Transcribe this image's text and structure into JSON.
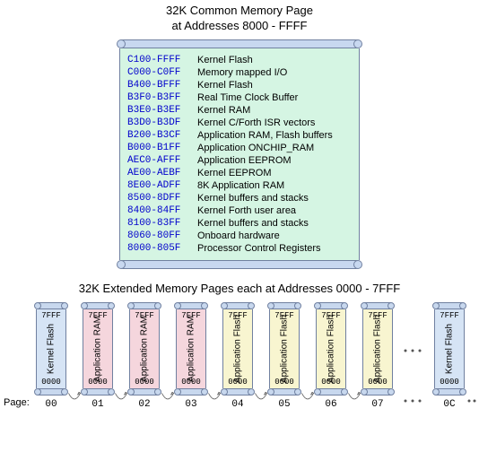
{
  "title_line1": "32K Common Memory Page",
  "title_line2": "at Addresses 8000 - FFFF",
  "common_rows": [
    {
      "addr": "C100-FFFF",
      "desc": "Kernel Flash"
    },
    {
      "addr": "C000-C0FF",
      "desc": "Memory mapped I/O"
    },
    {
      "addr": "B400-BFFF",
      "desc": "Kernel Flash"
    },
    {
      "addr": "B3F0-B3FF",
      "desc": "Real Time Clock Buffer"
    },
    {
      "addr": "B3E0-B3EF",
      "desc": "Kernel RAM"
    },
    {
      "addr": "B3D0-B3DF",
      "desc": "Kernel C/Forth ISR vectors"
    },
    {
      "addr": "B200-B3CF",
      "desc": "Application RAM, Flash buffers"
    },
    {
      "addr": "B000-B1FF",
      "desc": "Application ONCHIP_RAM"
    },
    {
      "addr": "AEC0-AFFF",
      "desc": "Application EEPROM"
    },
    {
      "addr": "AE00-AEBF",
      "desc": "Kernel EEPROM"
    },
    {
      "addr": "8E00-ADFF",
      "desc": "8K Application RAM"
    },
    {
      "addr": "8500-8DFF",
      "desc": "Kernel buffers and stacks"
    },
    {
      "addr": "8400-84FF",
      "desc": "Kernel Forth user area"
    },
    {
      "addr": "8100-83FF",
      "desc": "Kernel buffers and stacks"
    },
    {
      "addr": "8060-80FF",
      "desc": "Onboard hardware"
    },
    {
      "addr": "8000-805F",
      "desc": "Processor Control Registers"
    }
  ],
  "ext_title": "32K Extended Memory Pages each at Addresses 0000 - 7FFF",
  "page_top_label": "7FFF",
  "page_bot_label": "0000",
  "page_row_label": "Page:",
  "pages": [
    {
      "num": "00",
      "label": "Kernel Flash",
      "color": "c-blue"
    },
    {
      "num": "01",
      "label": "Application RAM",
      "color": "c-pink"
    },
    {
      "num": "02",
      "label": "Application RAM",
      "color": "c-pink"
    },
    {
      "num": "03",
      "label": "Application RAM",
      "color": "c-pink"
    },
    {
      "num": "04",
      "label": "Application Flash",
      "color": "c-yellow"
    },
    {
      "num": "05",
      "label": "Application Flash",
      "color": "c-yellow"
    },
    {
      "num": "06",
      "label": "Application Flash",
      "color": "c-yellow"
    },
    {
      "num": "07",
      "label": "Application Flash",
      "color": "c-yellow"
    },
    {
      "num": "0C",
      "label": "Kernel Flash",
      "color": "c-blue"
    }
  ]
}
